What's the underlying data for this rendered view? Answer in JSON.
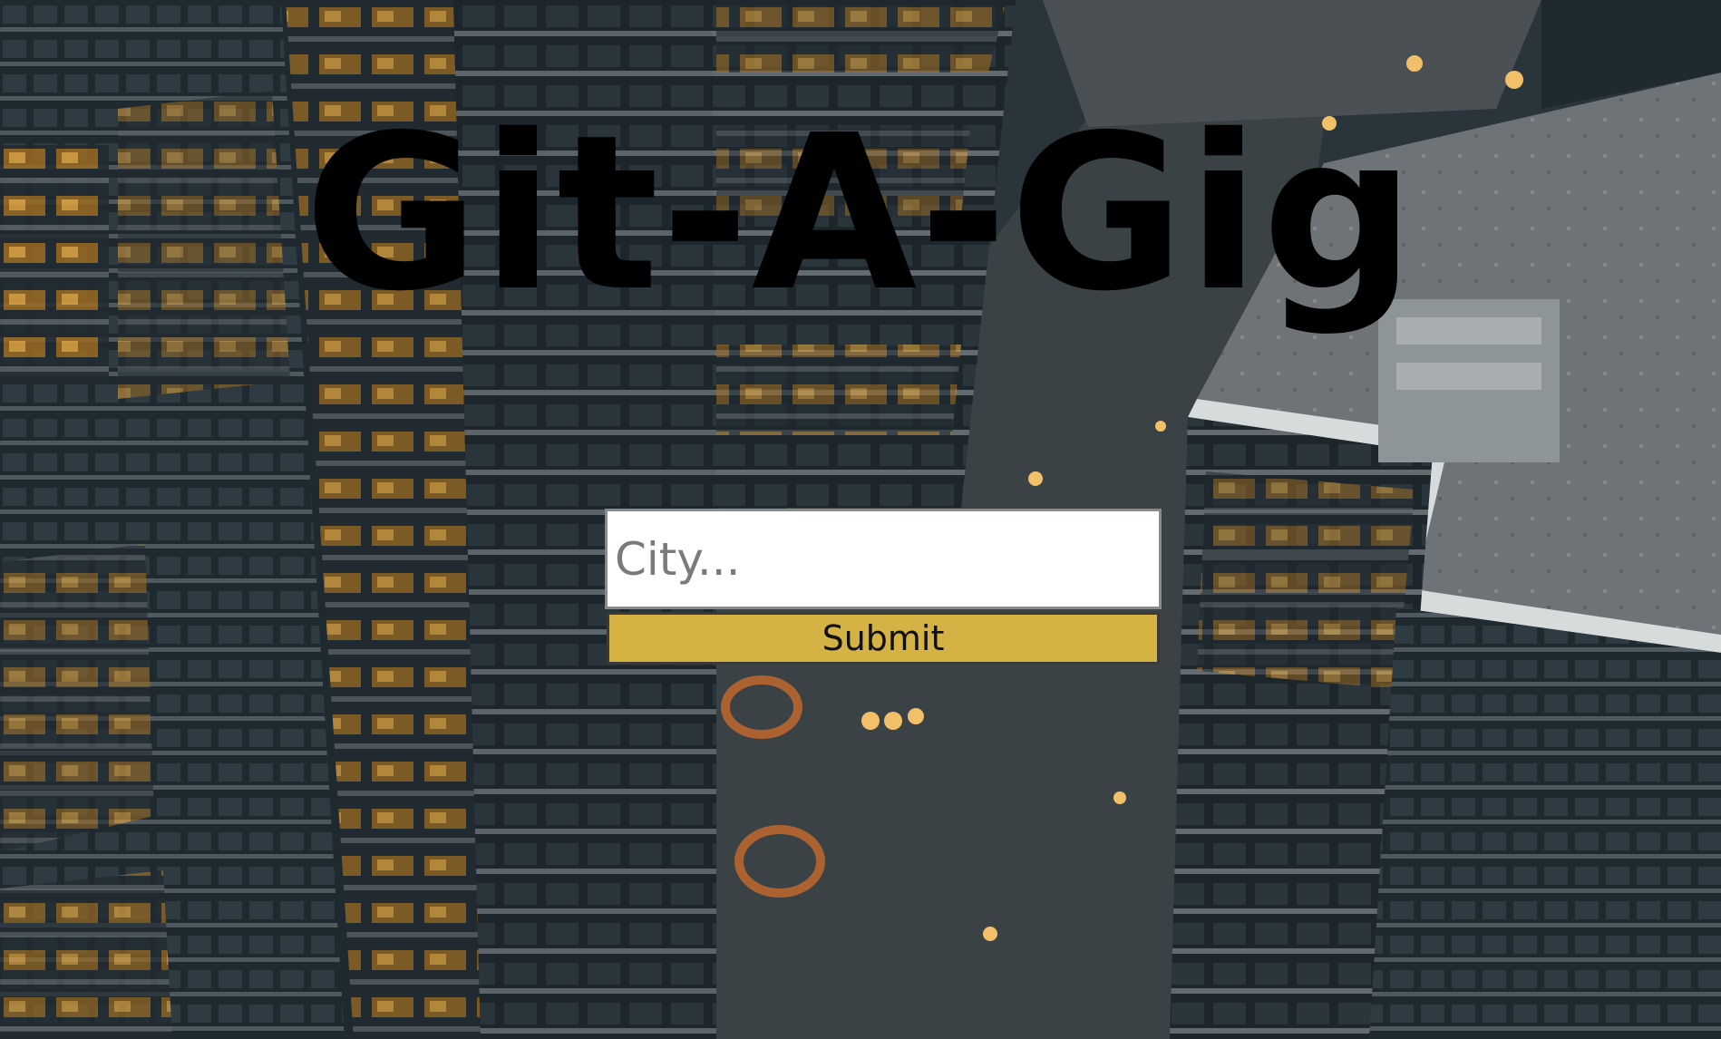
{
  "app": {
    "title": "Git-A-Gig"
  },
  "search": {
    "placeholder": "City...",
    "value": "",
    "submit_label": "Submit"
  },
  "background": {
    "description_icon": "city-aerial-photo",
    "accent_color": "#d4b243"
  }
}
